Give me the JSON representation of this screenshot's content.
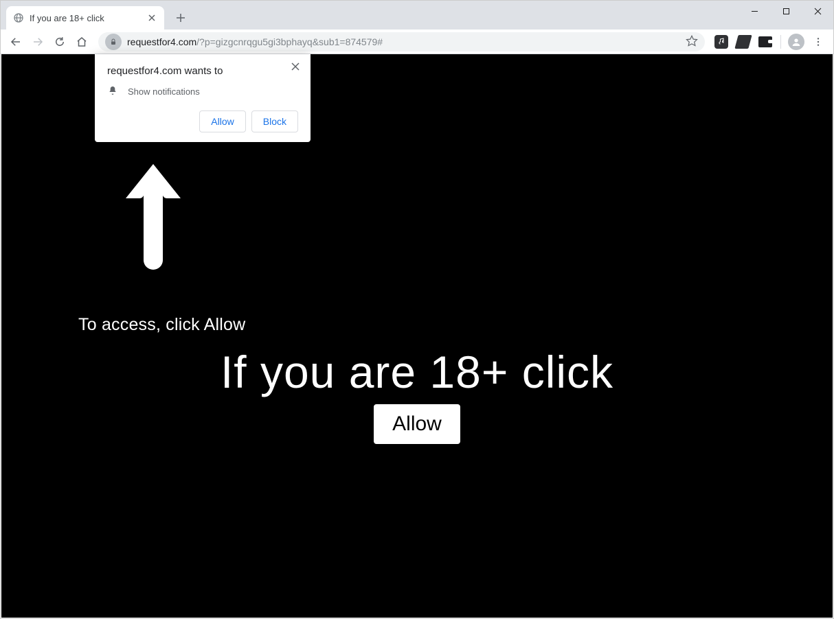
{
  "tab": {
    "title": "If you are 18+ click"
  },
  "url": {
    "host": "requestfor4.com",
    "path": "/?p=gizgcnrqgu5gi3bphayq&sub1=874579#"
  },
  "dialog": {
    "title": "requestfor4.com wants to",
    "permission": "Show notifications",
    "allow": "Allow",
    "block": "Block"
  },
  "page": {
    "hint": "To access, click Allow",
    "headline": "If you are 18+ click",
    "button": "Allow"
  }
}
